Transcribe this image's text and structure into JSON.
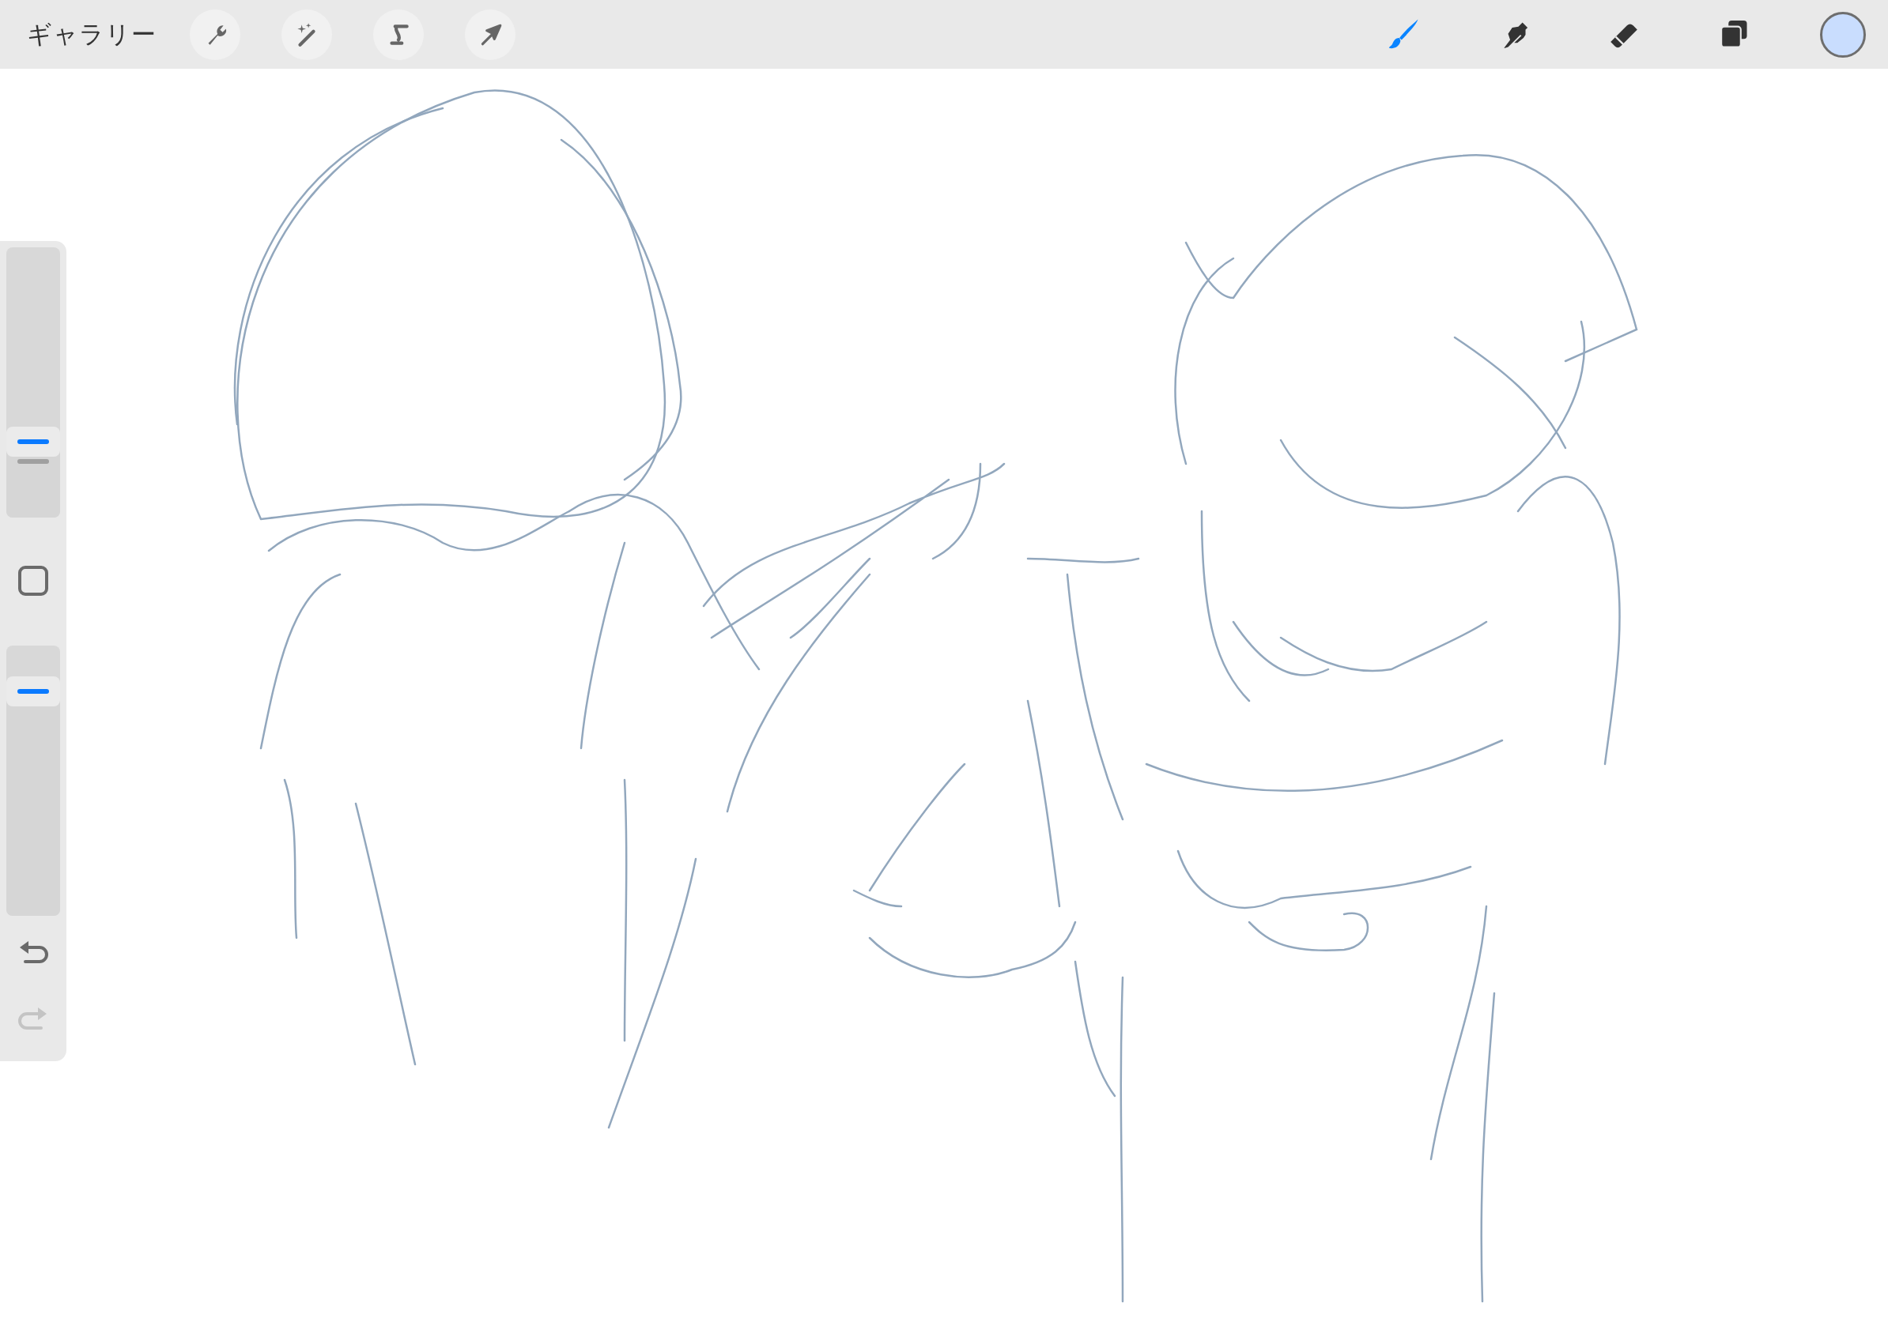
{
  "top_bar": {
    "gallery_label": "ギャラリー",
    "left_tools": [
      {
        "kind": "wrench",
        "selected": false
      },
      {
        "kind": "wand",
        "selected": false
      },
      {
        "kind": "selection",
        "selected": false
      },
      {
        "kind": "arrow",
        "selected": false
      }
    ],
    "right_tools": [
      {
        "kind": "brush",
        "selected": true
      },
      {
        "kind": "smudge",
        "selected": false
      },
      {
        "kind": "eraser",
        "selected": false
      },
      {
        "kind": "layers",
        "selected": false
      }
    ]
  },
  "sidebar": {
    "sliders": [
      {
        "kind": "size",
        "level": 0.28
      },
      {
        "kind": "opacity",
        "level": 0.83
      }
    ],
    "undo": {
      "disabled": false
    },
    "redo": {
      "disabled": true
    }
  }
}
